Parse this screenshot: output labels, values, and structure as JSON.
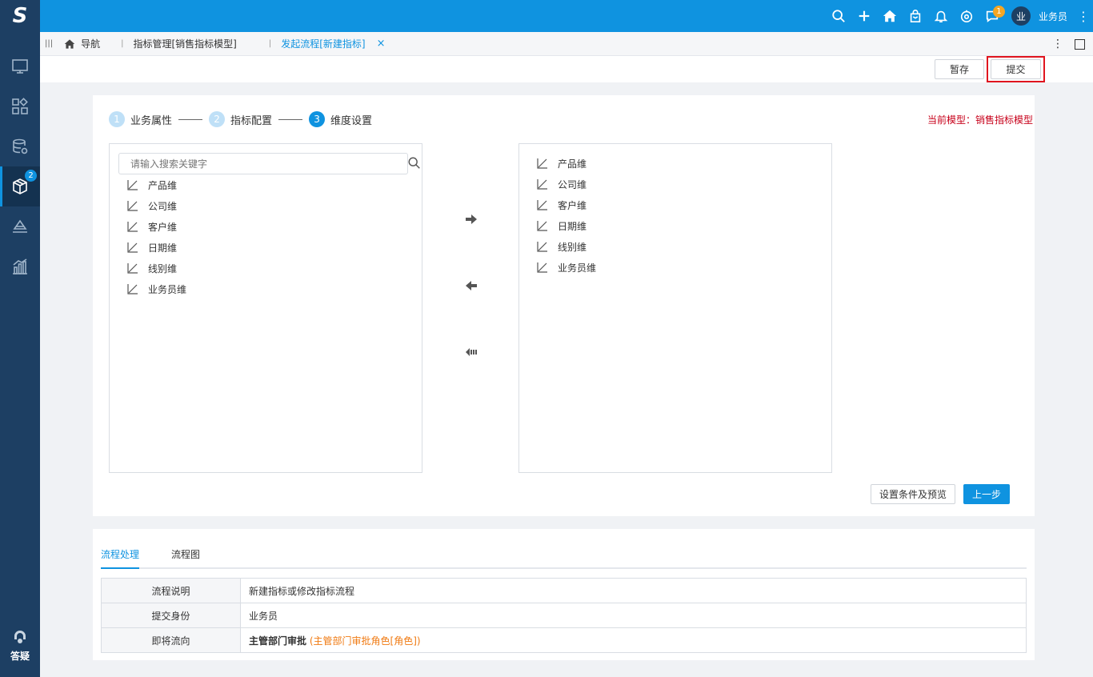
{
  "app": {
    "logo_text": "S",
    "brand_color": "#0f93e0",
    "sidebar_color": "#1d3f63"
  },
  "topbar": {
    "icons": [
      "search-icon",
      "plus-icon",
      "home-icon",
      "shopping-bag-icon",
      "bell-icon",
      "settings-icon",
      "chat-icon"
    ],
    "chat_badge": "1",
    "avatar_text": "业",
    "username": "业务员"
  },
  "sidebar": {
    "items": [
      {
        "icon": "monitor-icon"
      },
      {
        "icon": "apps-icon"
      },
      {
        "icon": "database-settings-icon"
      },
      {
        "icon": "cube-icon",
        "badge": "2",
        "active": true
      },
      {
        "icon": "layers-icon"
      },
      {
        "icon": "bar-chart-icon"
      }
    ],
    "help_label": "答疑"
  },
  "tabs": [
    {
      "label": "导航",
      "icon": "home-icon"
    },
    {
      "label": "指标管理[销售指标模型]"
    },
    {
      "label": "发起流程[新建指标]",
      "active": true,
      "closable": true
    }
  ],
  "actions": {
    "save_label": "暂存",
    "submit_label": "提交"
  },
  "steps": [
    {
      "num": "1",
      "label": "业务属性"
    },
    {
      "num": "2",
      "label": "指标配置"
    },
    {
      "num": "3",
      "label": "维度设置",
      "current": true
    }
  ],
  "current_model": "当前模型：销售指标模型",
  "left_list": {
    "search_placeholder": "请输入搜索关键字",
    "items": [
      "产品维",
      "公司维",
      "客户维",
      "日期维",
      "线别维",
      "业务员维"
    ]
  },
  "right_list": {
    "items": [
      "产品维",
      "公司维",
      "客户维",
      "日期维",
      "线别维",
      "业务员维"
    ]
  },
  "transfer": [
    "move-right-icon",
    "move-left-icon",
    "move-all-left-icon"
  ],
  "footer_buttons": {
    "preview_label": "设置条件及预览",
    "prev_label": "上一步"
  },
  "flow": {
    "tabs": [
      "流程处理",
      "流程图"
    ],
    "rows": [
      {
        "key": "流程说明",
        "value": "新建指标或修改指标流程"
      },
      {
        "key": "提交身份",
        "value": "业务员"
      },
      {
        "key": "即将流向",
        "value": "主管部门审批",
        "extra": "(主管部门审批角色[角色])"
      }
    ]
  }
}
